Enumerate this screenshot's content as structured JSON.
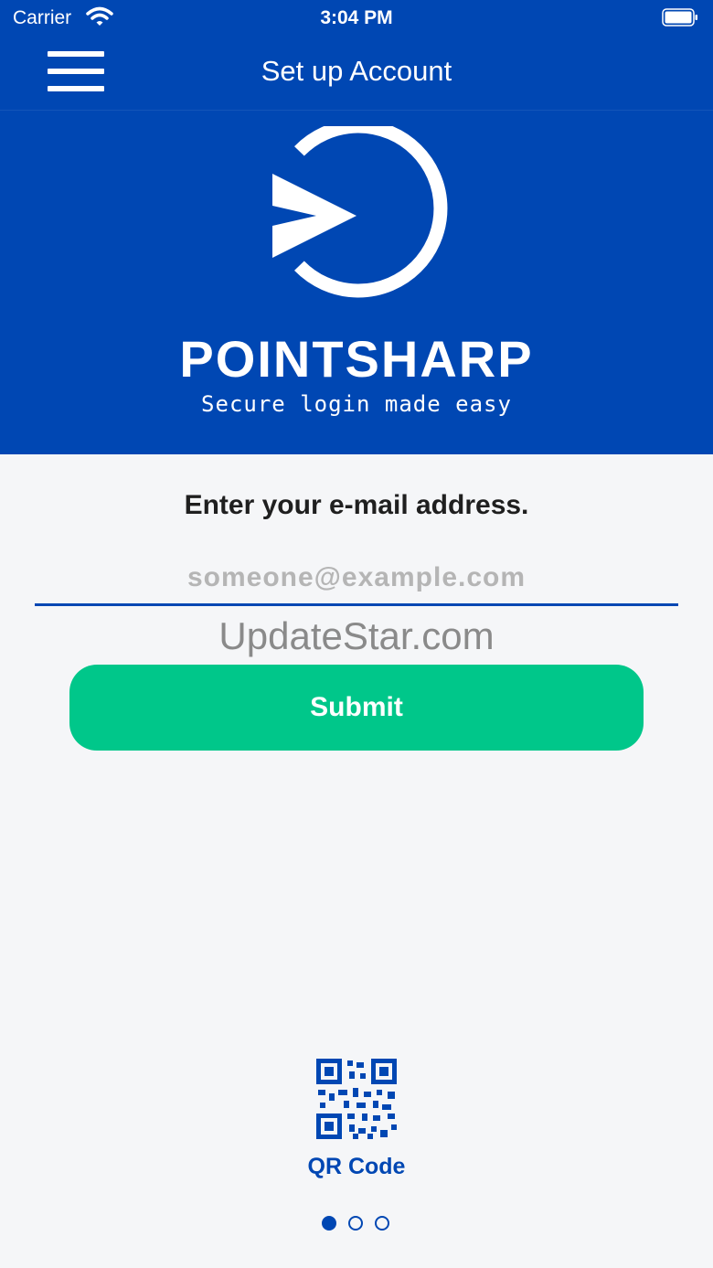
{
  "status_bar": {
    "carrier": "Carrier",
    "time": "3:04 PM",
    "icons": [
      "wifi-icon",
      "battery-icon"
    ]
  },
  "nav": {
    "title": "Set up Account",
    "menu_icon": "hamburger-menu-icon"
  },
  "branding": {
    "logo_icon": "pointsharp-logo-icon",
    "name": "POINTSHARP",
    "tagline": "Secure login made easy"
  },
  "form": {
    "prompt": "Enter your e-mail address.",
    "email_value": "",
    "email_placeholder": "someone@example.com",
    "submit_label": "Submit"
  },
  "watermark": "UpdateStar.com",
  "qr": {
    "icon": "qr-code-icon",
    "label": "QR Code"
  },
  "pager": {
    "total": 3,
    "active_index": 0
  },
  "colors": {
    "brand_blue": "#0047b3",
    "submit_green": "#00c78a",
    "background": "#f5f6f8"
  }
}
